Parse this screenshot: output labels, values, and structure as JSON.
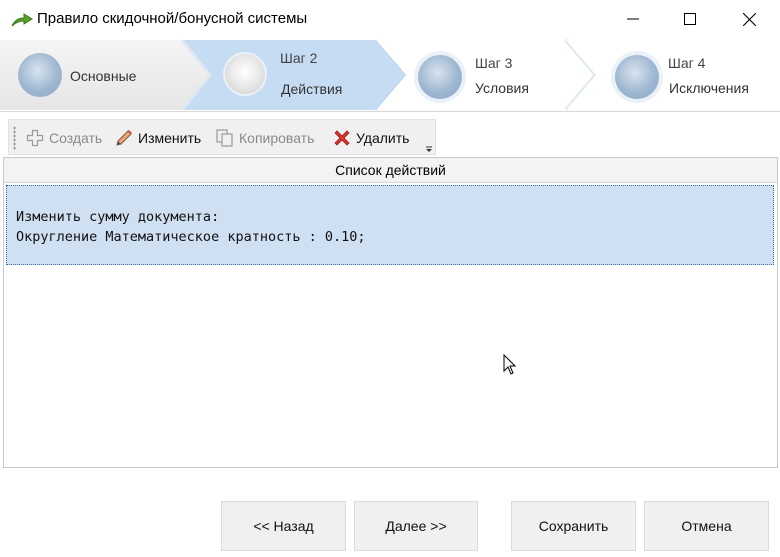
{
  "window": {
    "title": "Правило скидочной/бонусной системы"
  },
  "wizard": {
    "steps": [
      {
        "number": "",
        "label": "Основные",
        "state": "done"
      },
      {
        "number": "Шаг 2",
        "label": "Действия",
        "state": "active"
      },
      {
        "number": "Шаг 3",
        "label": "Условия",
        "state": "pending"
      },
      {
        "number": "Шаг 4",
        "label": "Исключения",
        "state": "pending"
      }
    ]
  },
  "toolbar": {
    "create_label": "Создать",
    "edit_label": "Изменить",
    "copy_label": "Копировать",
    "delete_label": "Удалить"
  },
  "actions_list": {
    "header": "Список действий",
    "items": [
      {
        "line1": "Изменить сумму документа:",
        "line2": "Округление Математическое кратность : 0.10;"
      }
    ]
  },
  "footer": {
    "back_label": "<< Назад",
    "next_label": "Далее >>",
    "save_label": "Сохранить",
    "cancel_label": "Отмена"
  },
  "colors": {
    "active_step": "#c6dcf2",
    "selection": "#cfe0f3",
    "delete_icon": "#d9332b",
    "app_icon": "#5aa02c"
  }
}
